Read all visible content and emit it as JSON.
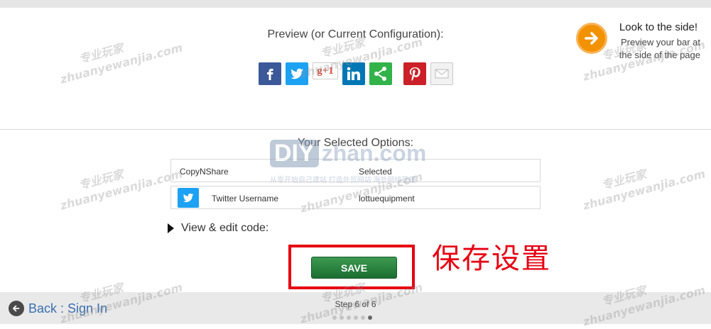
{
  "preview": {
    "title": "Preview (or Current Configuration):",
    "gplus_label": "g+1"
  },
  "side_hint": {
    "title": "Look to the side!",
    "subtitle": "Preview your bar at the side of the page"
  },
  "options": {
    "title": "Your Selected Options:",
    "rows": [
      {
        "label": "CopyNShare",
        "value": "Selected"
      },
      {
        "label": "Twitter Username",
        "value": "lottuequipment"
      }
    ]
  },
  "edit_code_label": "View & edit code:",
  "save_label": "SAVE",
  "annotation_text": "保存设置",
  "footer": {
    "back_label": "Back : Sign In",
    "step_text": "Step 6 of 6",
    "total_steps": 6,
    "current_step": 6
  },
  "watermark": {
    "brand_tag": "专业玩家",
    "site": "zhuanyewanjia.com",
    "logo_diy": "DIY",
    "logo_zhan": "zhan.com",
    "logo_sub": "从零开始自己建站 打造外贸网站 海外网络营销"
  },
  "colors": {
    "facebook": "#3b5998",
    "twitter": "#1da1f2",
    "linkedin": "#0077b5",
    "share": "#32b34a",
    "pinterest": "#cb2027",
    "save_green": "#1b6e32",
    "annotation_red": "#e60012",
    "side_orange": "#f39200",
    "link_blue": "#3a6fb0"
  },
  "icons": [
    "facebook-icon",
    "twitter-icon",
    "google-plus-icon",
    "linkedin-icon",
    "share-icon",
    "pinterest-icon",
    "email-icon",
    "arrow-right-icon",
    "back-arrow-icon"
  ]
}
